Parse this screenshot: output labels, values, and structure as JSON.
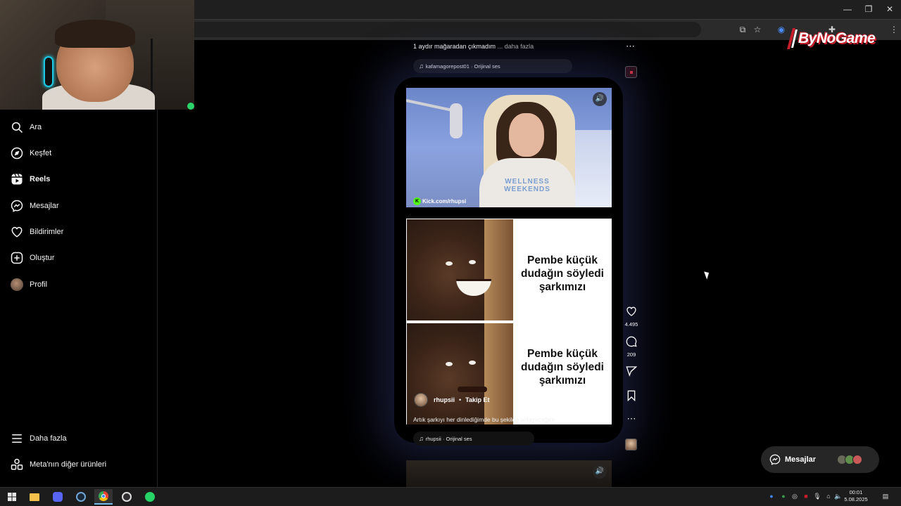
{
  "browser": {
    "window_buttons": [
      "—",
      "❐",
      "✕"
    ]
  },
  "sidebar": {
    "items": [
      {
        "label": "Ara",
        "icon": "search-icon"
      },
      {
        "label": "Keşfet",
        "icon": "compass-icon"
      },
      {
        "label": "Reels",
        "icon": "reels-icon",
        "active": true
      },
      {
        "label": "Mesajlar",
        "icon": "messenger-icon"
      },
      {
        "label": "Bildirimler",
        "icon": "heart-icon"
      },
      {
        "label": "Oluştur",
        "icon": "plus-square-icon"
      },
      {
        "label": "Profil",
        "icon": "avatar"
      }
    ],
    "bottom": [
      {
        "label": "Daha fazla",
        "icon": "menu-icon"
      },
      {
        "label": "Meta'nın diğer ürünleri",
        "icon": "grid-icon"
      }
    ]
  },
  "prev_reel": {
    "caption": "1 aydır mağaradan çıkmadım",
    "more_link": "... daha fazla",
    "audio": "kafamagorepost01 · Orijinal ses"
  },
  "reel": {
    "stream_link": "Kick.com/rhupsi",
    "shirt_text": "WELLNESS WEEKENDS",
    "meme_text_top": "Pembe küçük dudağın söyledi şarkımızı",
    "meme_text_bottom": "Pembe küçük dudağın söyledi şarkımızı",
    "username": "rhupsii",
    "separator": "•",
    "follow_label": "Takip Et",
    "caption": "Artık şarkıyı her dinlediğimde bu şekilde anlayacağım",
    "audio": "rhupsii · Orijinal ses",
    "likes": "4.495",
    "comments": "209"
  },
  "messages_pill": {
    "label": "Mesajlar"
  },
  "overlay_logo": {
    "text": "ByNoGame"
  },
  "taskbar": {
    "time": "00:01",
    "date": "5.08.2025"
  },
  "colors": {
    "background": "#000000",
    "accent_red": "#c81d2a",
    "kick_green": "#53fc18"
  }
}
